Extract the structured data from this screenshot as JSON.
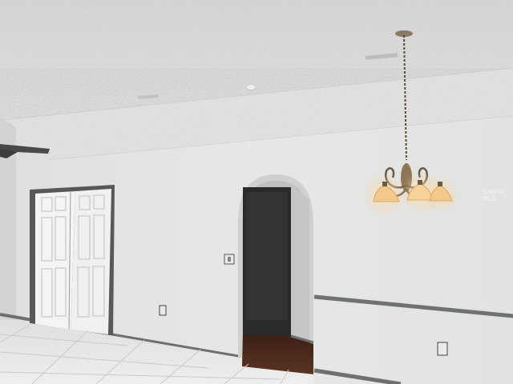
{
  "scene": {
    "description_tags": [
      "interior-room",
      "textured-ceiling",
      "arched-doorway",
      "double-closet-door",
      "chandelier",
      "ceiling-fan",
      "tile-floor"
    ],
    "watermark_text": "Stellar MLS",
    "colors": {
      "ceiling": "#e3e3e1",
      "wall": "#e4e4e2",
      "wall_shadow": "#cfcfcd",
      "baseboard": "#6f6f6f",
      "chair_rail": "#707272",
      "door": "#f3f3f3",
      "door_frame": "#585858",
      "floor_tile": "#e6e7e6",
      "hallway_floor": "#4a2a1c",
      "hallway_wall": "#2f2f2f",
      "lamp_glass": "#f3c98a",
      "chain": "#5a4a3a"
    }
  }
}
